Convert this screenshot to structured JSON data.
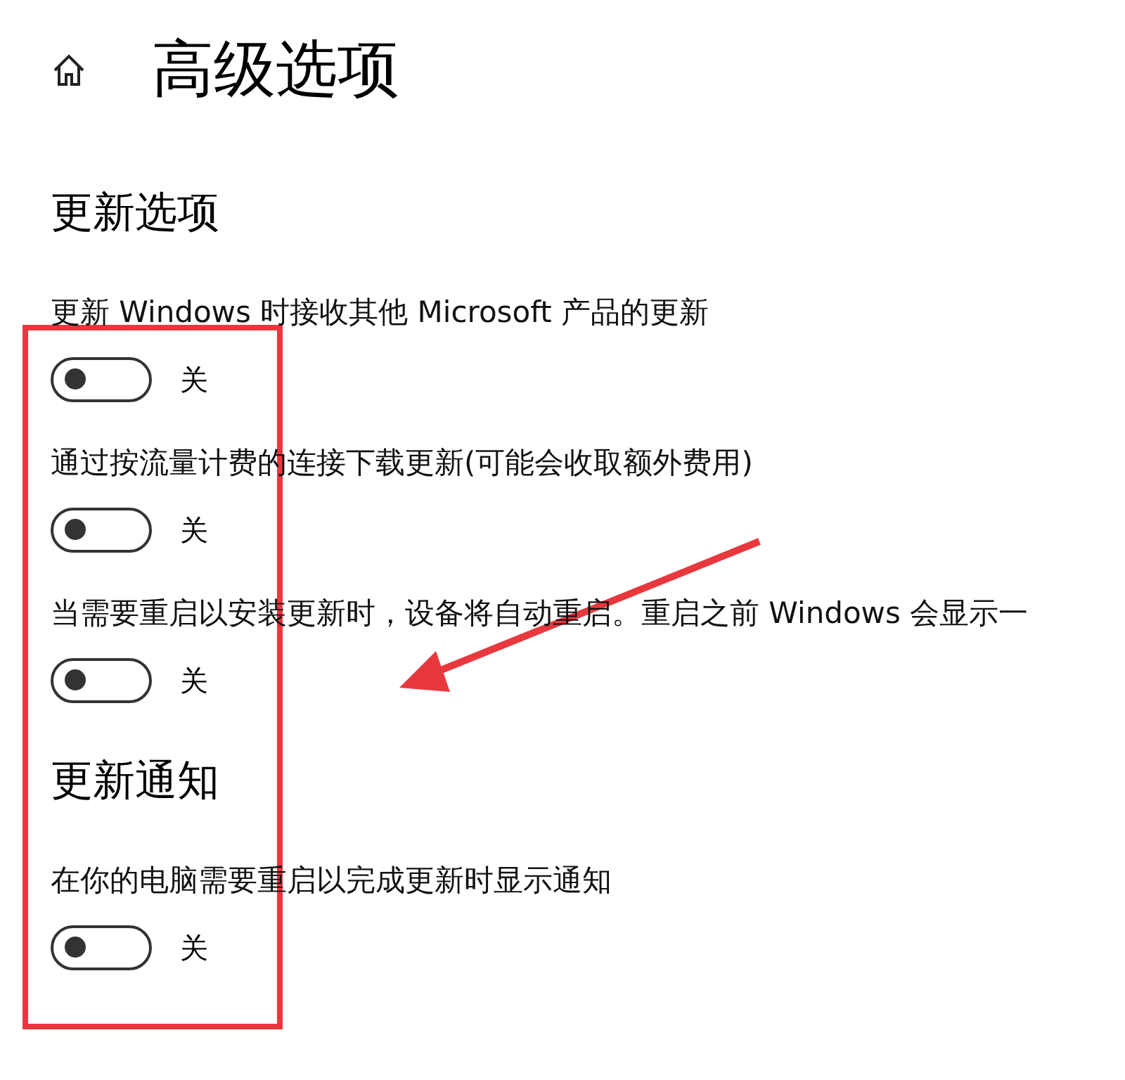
{
  "page": {
    "title": "高级选项"
  },
  "sections": [
    {
      "heading": "更新选项",
      "settings": [
        {
          "label": "更新 Windows 时接收其他 Microsoft 产品的更新",
          "on": false,
          "state_text": "关"
        },
        {
          "label": "通过按流量计费的连接下载更新(可能会收取额外费用)",
          "on": false,
          "state_text": "关"
        },
        {
          "label": "当需要重启以安装更新时，设备将自动重启。重启之前 Windows 会显示一",
          "on": false,
          "state_text": "关"
        }
      ]
    },
    {
      "heading": "更新通知",
      "settings": [
        {
          "label": "在你的电脑需要重启以完成更新时显示通知",
          "on": false,
          "state_text": "关"
        }
      ]
    }
  ]
}
